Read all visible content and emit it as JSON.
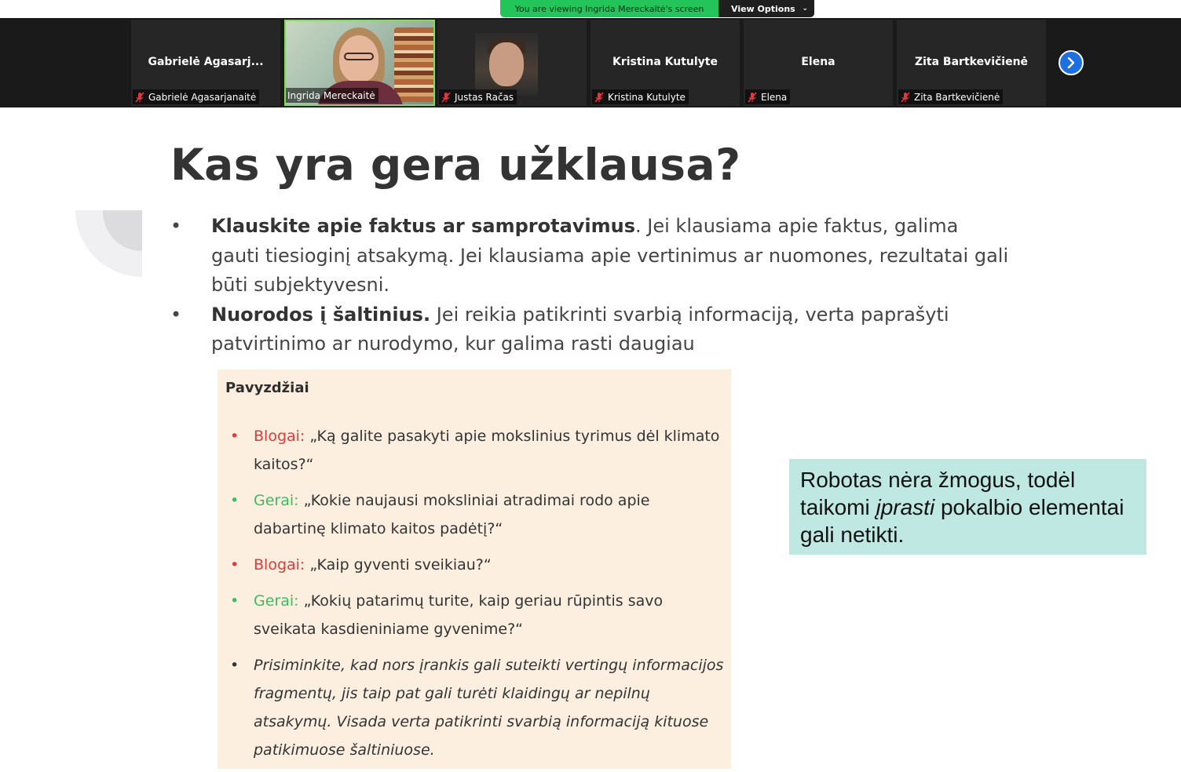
{
  "banner": {
    "viewing_text": "You are viewing Ingrida Mereckaitė's screen",
    "view_options_label": "View Options"
  },
  "participants": [
    {
      "center_name": "Gabrielė Agasarj...",
      "label": "Gabrielė Agasarjanaitė",
      "muted": true
    },
    {
      "center_name": "",
      "label": "Ingrida Mereckaitė",
      "muted": false
    },
    {
      "center_name": "",
      "label": "Justas Račas",
      "muted": true
    },
    {
      "center_name": "Kristina Kutulyte",
      "label": "Kristina Kutulyte",
      "muted": true
    },
    {
      "center_name": "Elena",
      "label": "Elena",
      "muted": true
    },
    {
      "center_name": "Zita Bartkevičienė",
      "label": "Zita Bartkevičienė",
      "muted": true
    }
  ],
  "slide": {
    "title": "Kas yra gera užklausa?",
    "bullets": [
      {
        "bold": "Klauskite apie faktus ar samprotavimus",
        "text": ". Jei klausiama apie faktus, galima gauti tiesioginį atsakymą. Jei klausiama apie vertinimus ar nuomones, rezultatai gali būti subjektyvesni."
      },
      {
        "bold": "Nuorodos į šaltinius.",
        "text": " Jei reikia patikrinti svarbią informaciją, verta paprašyti patvirtinimo ar nurodymo, kur galima rasti daugiau"
      }
    ],
    "examples": {
      "heading": "Pavyzdžiai",
      "items": [
        {
          "tag": "Blogai:",
          "kind": "bad",
          "text": " „Ką galite pasakyti apie mokslinius tyrimus dėl klimato kaitos?“"
        },
        {
          "tag": "Gerai:",
          "kind": "good",
          "text": " „Kokie naujausi moksliniai atradimai rodo apie dabartinę klimato kaitos padėtį?“"
        },
        {
          "tag": "Blogai:",
          "kind": "bad",
          "text": " „Kaip gyventi sveikiau?“"
        },
        {
          "tag": "Gerai:",
          "kind": "good",
          "text": " „Kokių patarimų turite, kaip geriau rūpintis savo sveikata kasdieniniame gyvenime?“"
        }
      ],
      "note": "Prisiminkite, kad nors įrankis gali suteikti vertingų informacijos fragmentų, jis taip pat gali turėti klaidingų ar nepilnų atsakymų. Visada verta patikrinti svarbią informaciją kituose patikimuose šaltiniuose."
    },
    "callout": {
      "before": "Robotas nėra žmogus, todėl taikomi ",
      "italic": "įprasti",
      "after": " pokalbio elementai gali netikti."
    }
  },
  "colors": {
    "banner_green": "#23c55a",
    "strip_bg": "#1a1a1a",
    "active_speaker_border": "#7fdd4f",
    "next_button": "#1e6fe0",
    "examples_bg": "#fcefdf",
    "bad": "#de3b3b",
    "good": "#3dbb5d",
    "callout_bg": "#bfe8e3"
  },
  "icons": {
    "muted": "mic-off-icon",
    "next": "chevron-right-icon",
    "dropdown": "chevron-down-icon"
  }
}
